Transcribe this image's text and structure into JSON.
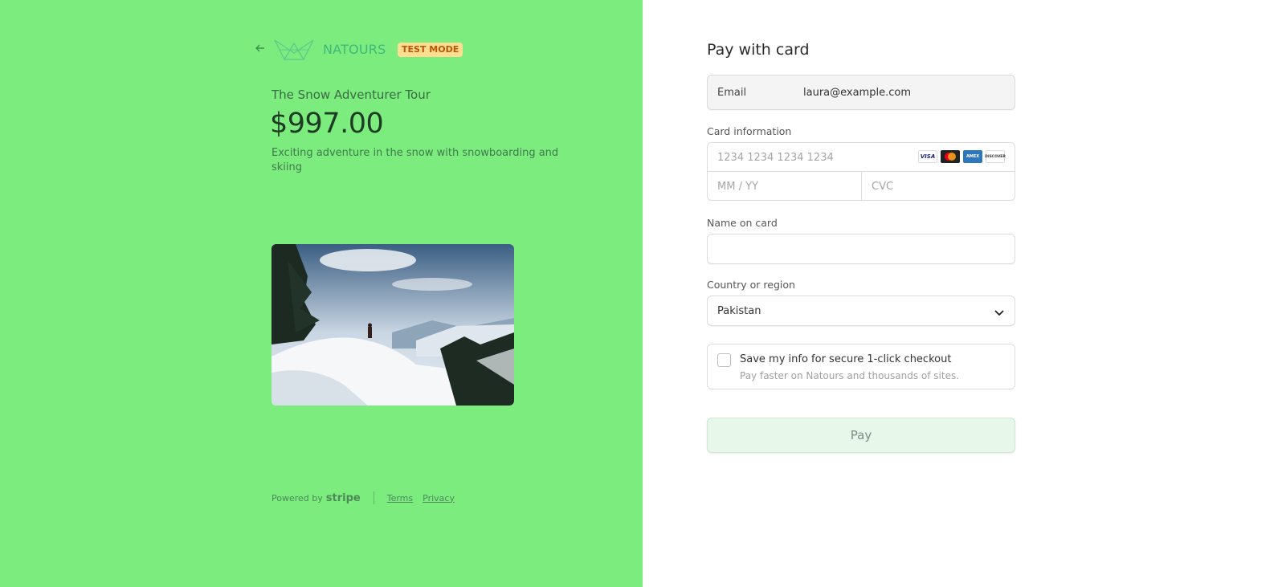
{
  "header": {
    "brand_name": "NATOURS",
    "badge": "TEST MODE",
    "back_icon": "arrow-left-icon",
    "logo_icon": "natours-logo-icon"
  },
  "product": {
    "name": "The Snow Adventurer Tour",
    "price": "$997.00",
    "description": "Exciting adventure in the snow with snowboarding and skiing",
    "image": "snowy-mountain-hiker-photo"
  },
  "footer": {
    "powered_by": "Powered by",
    "stripe": "stripe",
    "terms": "Terms",
    "privacy": "Privacy"
  },
  "form": {
    "title": "Pay with card",
    "email_label": "Email",
    "email_value": "laura@example.com",
    "card_label": "Card information",
    "card_number_placeholder": "1234 1234 1234 1234",
    "expiry_placeholder": "MM / YY",
    "cvc_placeholder": "CVC",
    "card_brands": [
      "VISA",
      "mastercard",
      "AMEX",
      "DISCOVER"
    ],
    "name_label": "Name on card",
    "name_value": "",
    "country_label": "Country or region",
    "country_value": "Pakistan",
    "save_title": "Save my info for secure 1-click checkout",
    "save_sub": "Pay faster on Natours and thousands of sites.",
    "pay_label": "Pay"
  },
  "colors": {
    "left_background": "#7cec7f",
    "brand_green": "#3fb879",
    "badge_bg": "#ffde92",
    "badge_text": "#bb5504",
    "pay_button_bg": "#e7f8ea"
  }
}
